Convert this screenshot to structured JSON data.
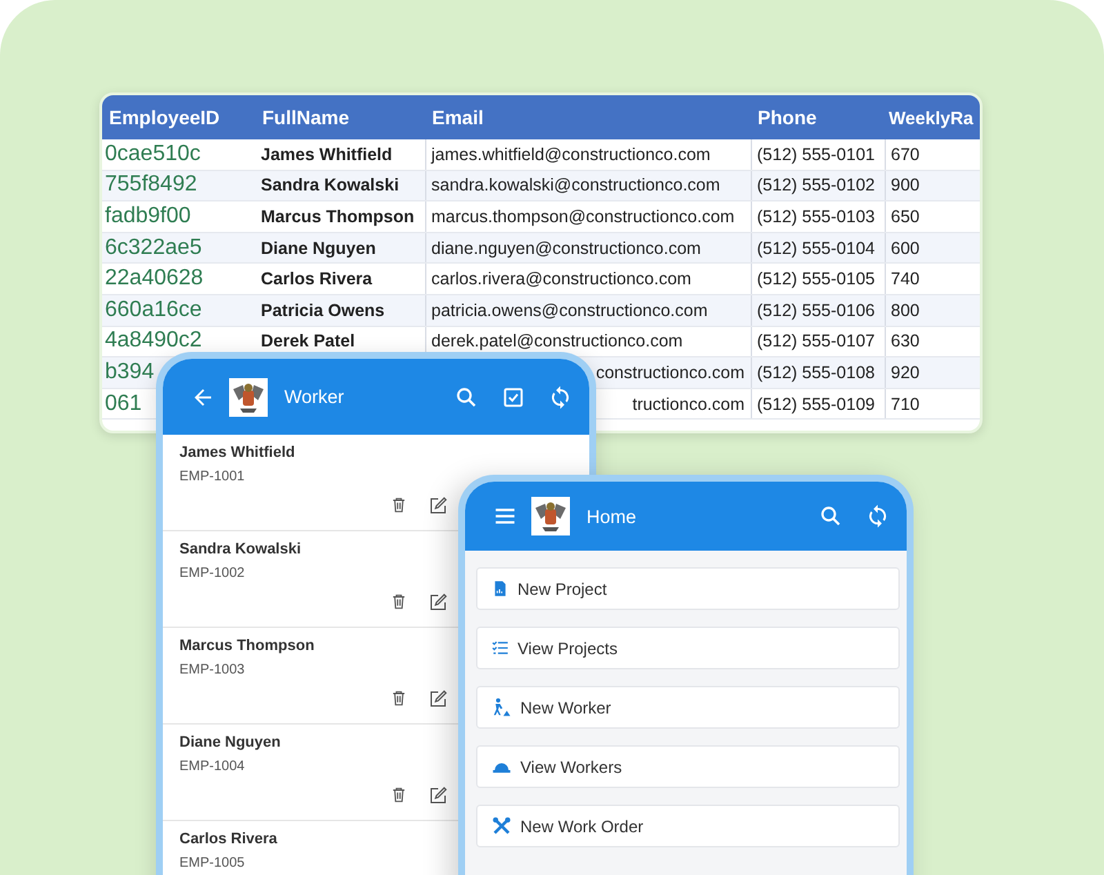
{
  "table": {
    "columns": [
      "EmployeeID",
      "FullName",
      "Email",
      "Phone",
      "WeeklyRa"
    ],
    "rows": [
      {
        "id": "0cae510c",
        "name": "James Whitfield",
        "email": "james.whitfield@constructionco.com",
        "phone": "(512) 555-0101",
        "rate": "670"
      },
      {
        "id": "755f8492",
        "name": "Sandra Kowalski",
        "email": "sandra.kowalski@constructionco.com",
        "phone": "(512) 555-0102",
        "rate": "900"
      },
      {
        "id": "fadb9f00",
        "name": "Marcus Thompson",
        "email": "marcus.thompson@constructionco.com",
        "phone": "(512) 555-0103",
        "rate": "650"
      },
      {
        "id": "6c322ae5",
        "name": "Diane Nguyen",
        "email": "diane.nguyen@constructionco.com",
        "phone": "(512) 555-0104",
        "rate": "600"
      },
      {
        "id": "22a40628",
        "name": "Carlos Rivera",
        "email": "carlos.rivera@constructionco.com",
        "phone": "(512) 555-0105",
        "rate": "740"
      },
      {
        "id": "660a16ce",
        "name": "Patricia Owens",
        "email": "patricia.owens@constructionco.com",
        "phone": "(512) 555-0106",
        "rate": "800"
      },
      {
        "id": "4a8490c2",
        "name": "Derek Patel",
        "email": "derek.patel@constructionco.com",
        "phone": "(512) 555-0107",
        "rate": "630"
      },
      {
        "id": "b394",
        "email": "constructionco.com",
        "phone": "(512) 555-0108",
        "rate": "920"
      },
      {
        "id": "061",
        "email": "tructionco.com",
        "phone": "(512) 555-0109",
        "rate": "710"
      }
    ]
  },
  "worker_screen": {
    "title": "Worker",
    "items": [
      {
        "name": "James Whitfield",
        "code": "EMP-1001"
      },
      {
        "name": "Sandra Kowalski",
        "code": "EMP-1002"
      },
      {
        "name": "Marcus Thompson",
        "code": "EMP-1003"
      },
      {
        "name": "Diane Nguyen",
        "code": "EMP-1004"
      },
      {
        "name": "Carlos Rivera",
        "code": "EMP-1005"
      }
    ]
  },
  "home_screen": {
    "title": "Home",
    "menu": [
      {
        "label": "New Project"
      },
      {
        "label": "View Projects"
      },
      {
        "label": "New Worker"
      },
      {
        "label": "View Workers"
      },
      {
        "label": "New Work Order"
      }
    ]
  }
}
